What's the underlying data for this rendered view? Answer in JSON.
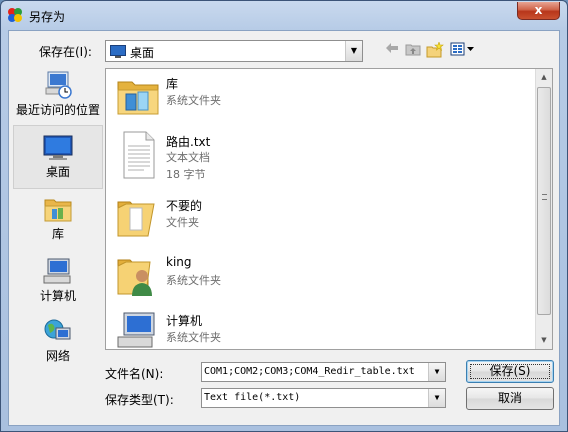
{
  "window": {
    "title": "另存为",
    "close_glyph": "x"
  },
  "toolbar": {
    "save_in_label": "保存在(I):",
    "location_value": "桌面",
    "icons": [
      "back-arrow-icon",
      "up-folder-icon",
      "new-folder-icon",
      "view-menu-icon"
    ]
  },
  "places": [
    {
      "label": "最近访问的位置",
      "icon": "recent-places-icon",
      "selected": false
    },
    {
      "label": "桌面",
      "icon": "desktop-icon",
      "selected": true
    },
    {
      "label": "库",
      "icon": "libraries-icon",
      "selected": false
    },
    {
      "label": "计算机",
      "icon": "computer-icon",
      "selected": false
    },
    {
      "label": "网络",
      "icon": "network-icon",
      "selected": false
    }
  ],
  "files": [
    {
      "name": "库",
      "type": "系统文件夹",
      "size": "",
      "icon": "libraries-folder-icon"
    },
    {
      "name": "路由.txt",
      "type": "文本文档",
      "size": "18 字节",
      "icon": "text-file-icon"
    },
    {
      "name": "不要的",
      "type": "文件夹",
      "size": "",
      "icon": "folder-icon"
    },
    {
      "name": "king",
      "type": "系统文件夹",
      "size": "",
      "icon": "user-folder-icon"
    },
    {
      "name": "计算机",
      "type": "系统文件夹",
      "size": "",
      "icon": "computer-icon"
    }
  ],
  "form": {
    "filename_label": "文件名(N):",
    "filename_value": "COM1;COM2;COM3;COM4_Redir_table.txt",
    "filetype_label": "保存类型(T):",
    "filetype_value": "Text file(*.txt)"
  },
  "buttons": {
    "save": "保存(S)",
    "cancel": "取消"
  },
  "colors": {
    "title_gradient_top": "#c9d9ee",
    "close_button": "#c9502f",
    "selection": "#e6e6e6"
  }
}
